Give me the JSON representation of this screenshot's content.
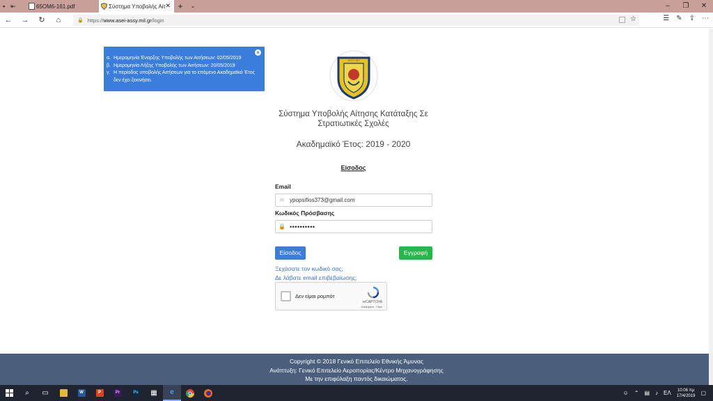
{
  "browser": {
    "tabs": [
      {
        "title": "65ΟΜ6-161.pdf",
        "active": false
      },
      {
        "title": "Σύστημα Υποβολής Αίτ",
        "active": true
      }
    ],
    "url_prefix": "https://",
    "url_host": "www.asei-assy.mil.gr",
    "url_path": "/login"
  },
  "alert": {
    "items": [
      {
        "letter": "α.",
        "text": "Ημερομηνία Έναρξης Υποβολής των Αιτήσεων: 02/05/2019"
      },
      {
        "letter": "β.",
        "text": "Ημερομηνία Λήξης Υποβολής των Αιτήσεων: 20/05/2019"
      },
      {
        "letter": "γ.",
        "text": "Η περίοδος υποβολής Αιτήσεων για το επόμενο Ακαδημαϊκό Έτος δεν έχει ξεκινήσει."
      }
    ],
    "close_label": "×"
  },
  "logo": {
    "text": "ΑΣΣΥ ΑΕΙ"
  },
  "page": {
    "title": "Σύστημα Υποβολής Αίτησης Κατάταξης Σε Στρατιωτικές Σχολές",
    "academic_year": "Ακαδημαϊκό Έτος: 2019 - 2020",
    "login_heading": "Είσοδος"
  },
  "form": {
    "email_label": "Email",
    "email_value": "ypopsifios373@gmail.com",
    "password_label": "Κωδικός Πρόσβασης",
    "password_masked": "••••••••••",
    "login_button": "Είσοδος",
    "register_button": "Εγγραφή",
    "forgot_link": "Ξεχάσατε τον κωδικό σας;",
    "resend_link": "Δε λάβατε email επιβεβαίωσης;"
  },
  "recaptcha": {
    "label": "Δεν είμαι ρομπότ",
    "brand": "reCAPTCHA",
    "terms": "Απόρρητο - Όροι"
  },
  "footer": {
    "line1": "Copyright © 2018 Γενικό Επιτελείο Εθνικής Άμυνας",
    "line2": "Ανάπτυξη: Γενικό Επιτελείο Αεροπορίας/Κέντρο Μηχανογράφησης",
    "line3": "Με την επιφύλαξη παντός δικαιώματος."
  },
  "taskbar": {
    "language": "ΕΛ",
    "time": "10:06 πμ",
    "date": "17/4/2019"
  },
  "colors": {
    "alert_bg": "#3b7ddd",
    "login_btn": "#3b7ddd",
    "register_btn": "#28b64a",
    "footer_bg": "#4b5f7d",
    "tabbar_bg": "#c99f9a"
  }
}
